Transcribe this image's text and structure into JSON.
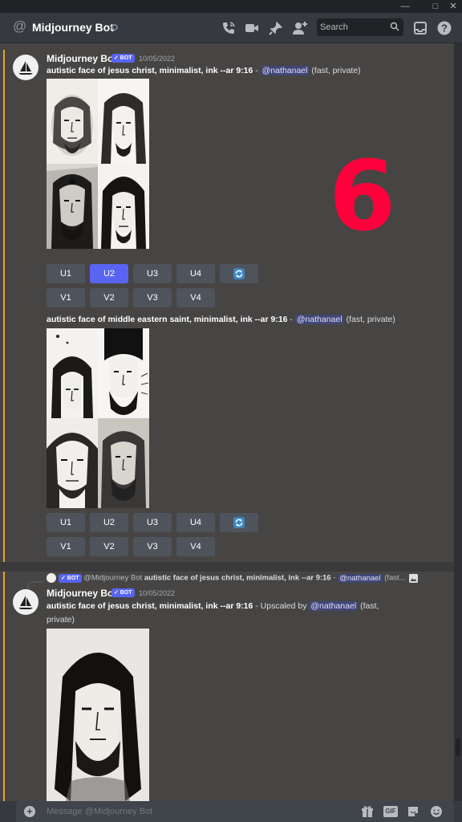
{
  "window": {
    "minimize_icon": "minimize-icon",
    "maximize_icon": "maximize-icon",
    "close_icon": "close-icon"
  },
  "header": {
    "at_symbol": "@",
    "channel_name": "Midjourney Bot",
    "search": {
      "placeholder": "Search"
    }
  },
  "overlay": {
    "number": "6"
  },
  "messages": [
    {
      "author": "Midjourney Bot",
      "bot_tag": "✓ BOT",
      "timestamp": "10/05/2022",
      "prompt": "autistic face of jesus christ, minimalist, ink --ar 9:16",
      "separator": " - ",
      "mention": "@nathanael",
      "suffix": " (fast, private)",
      "upscale_buttons": [
        "U1",
        "U2",
        "U3",
        "U4"
      ],
      "variation_buttons": [
        "V1",
        "V2",
        "V3",
        "V4"
      ],
      "active_button": "U2"
    },
    {
      "prompt": "autistic face of middle eastern saint, minimalist, ink --ar 9:16",
      "separator": " - ",
      "mention": "@nathanael",
      "suffix": " (fast, private)",
      "upscale_buttons": [
        "U1",
        "U2",
        "U3",
        "U4"
      ],
      "variation_buttons": [
        "V1",
        "V2",
        "V3",
        "V4"
      ]
    },
    {
      "reply": {
        "bot_tag": "✓ BOT",
        "author": "@Midjourney Bot",
        "prompt": "autistic face of jesus christ, minimalist, ink --ar 9:16",
        "separator": " - ",
        "mention": "@nathanael",
        "suffix": " (fast..."
      },
      "author": "Midjourney Bot",
      "bot_tag": "✓ BOT",
      "timestamp": "10/05/2022",
      "prompt": "autistic face of jesus christ, minimalist, ink --ar 9:16",
      "upscaled_by": " - Upscaled by ",
      "mention": "@nathanael",
      "suffix_line1": " (fast,",
      "suffix_line2": "private)"
    }
  ],
  "composer": {
    "placeholder": "Message @Midjourney Bot",
    "gif_label": "GIF"
  },
  "colors": {
    "accent": "#5865f2",
    "mention_bar": "#d9a530",
    "chat_bg": "#474544",
    "overlay_number": "#ff003c"
  }
}
